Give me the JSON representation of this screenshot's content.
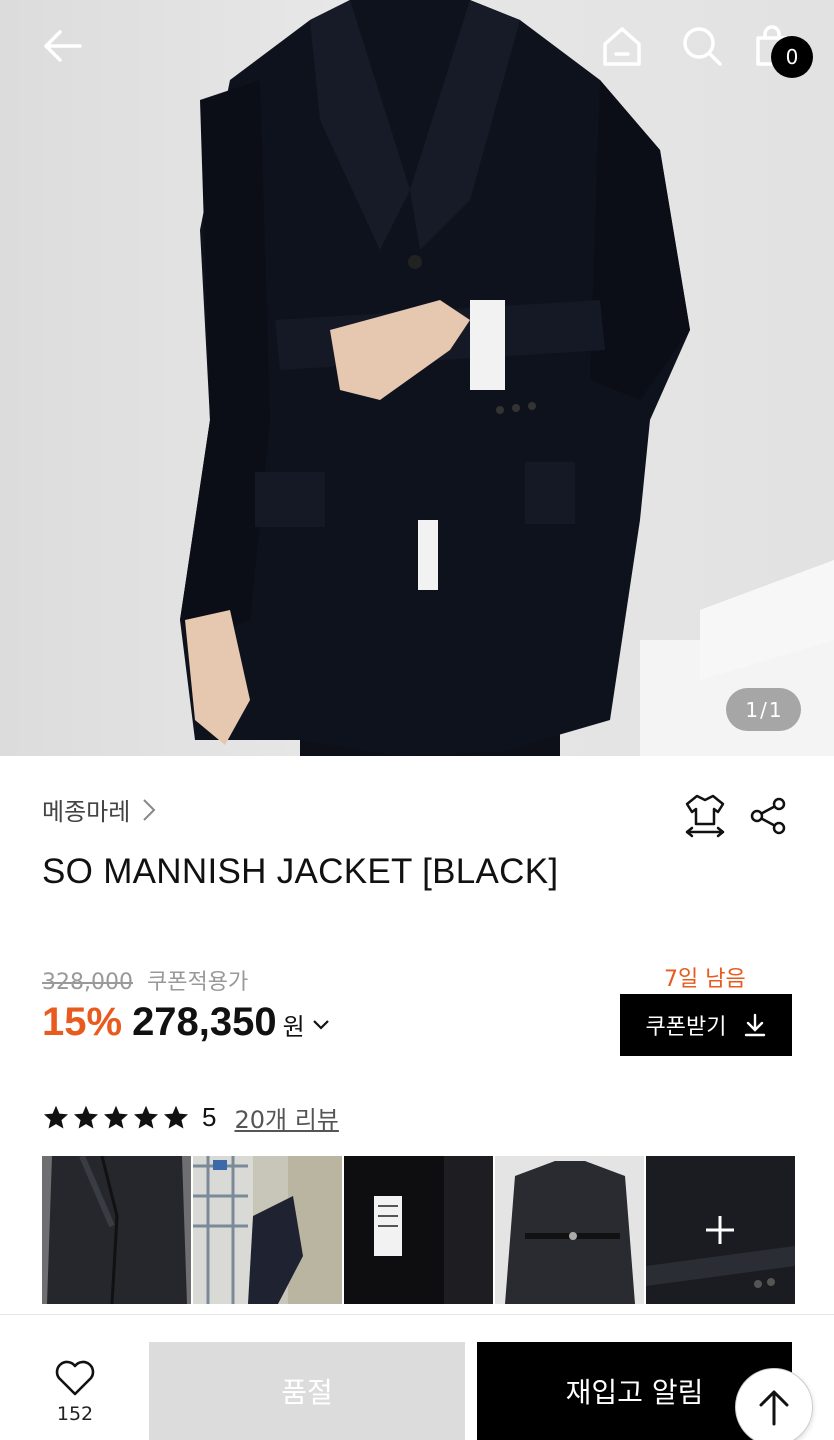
{
  "hero": {
    "counter_current": "1",
    "counter_sep": "/",
    "counter_total": "1"
  },
  "header": {
    "cart_count": "0"
  },
  "product": {
    "brand": "메종마레",
    "title": "SO MANNISH JACKET [BLACK]",
    "original_price": "328,000",
    "coupon_label": "쿠폰적용가",
    "discount": "15%",
    "sale_price": "278,350",
    "currency": "원",
    "days_left": "7일 남음",
    "coupon_button": "쿠폰받기"
  },
  "reviews": {
    "rating_value": "5",
    "rating_stars": 5,
    "review_link": "20개 리뷰"
  },
  "bottom_bar": {
    "like_count": "152",
    "soldout_label": "품절",
    "restock_label": "재입고 알림"
  },
  "icons": [
    "back-arrow-icon",
    "home-icon",
    "search-icon",
    "cart-icon",
    "size-guide-icon",
    "share-icon",
    "chevron-right-icon",
    "chevron-down-icon",
    "download-icon",
    "star-icon",
    "plus-icon",
    "heart-icon",
    "arrow-up-icon"
  ],
  "colors": {
    "accent": "#e85a1d",
    "primary": "#000000",
    "muted": "#999999",
    "disabled": "#dcdcdc"
  }
}
